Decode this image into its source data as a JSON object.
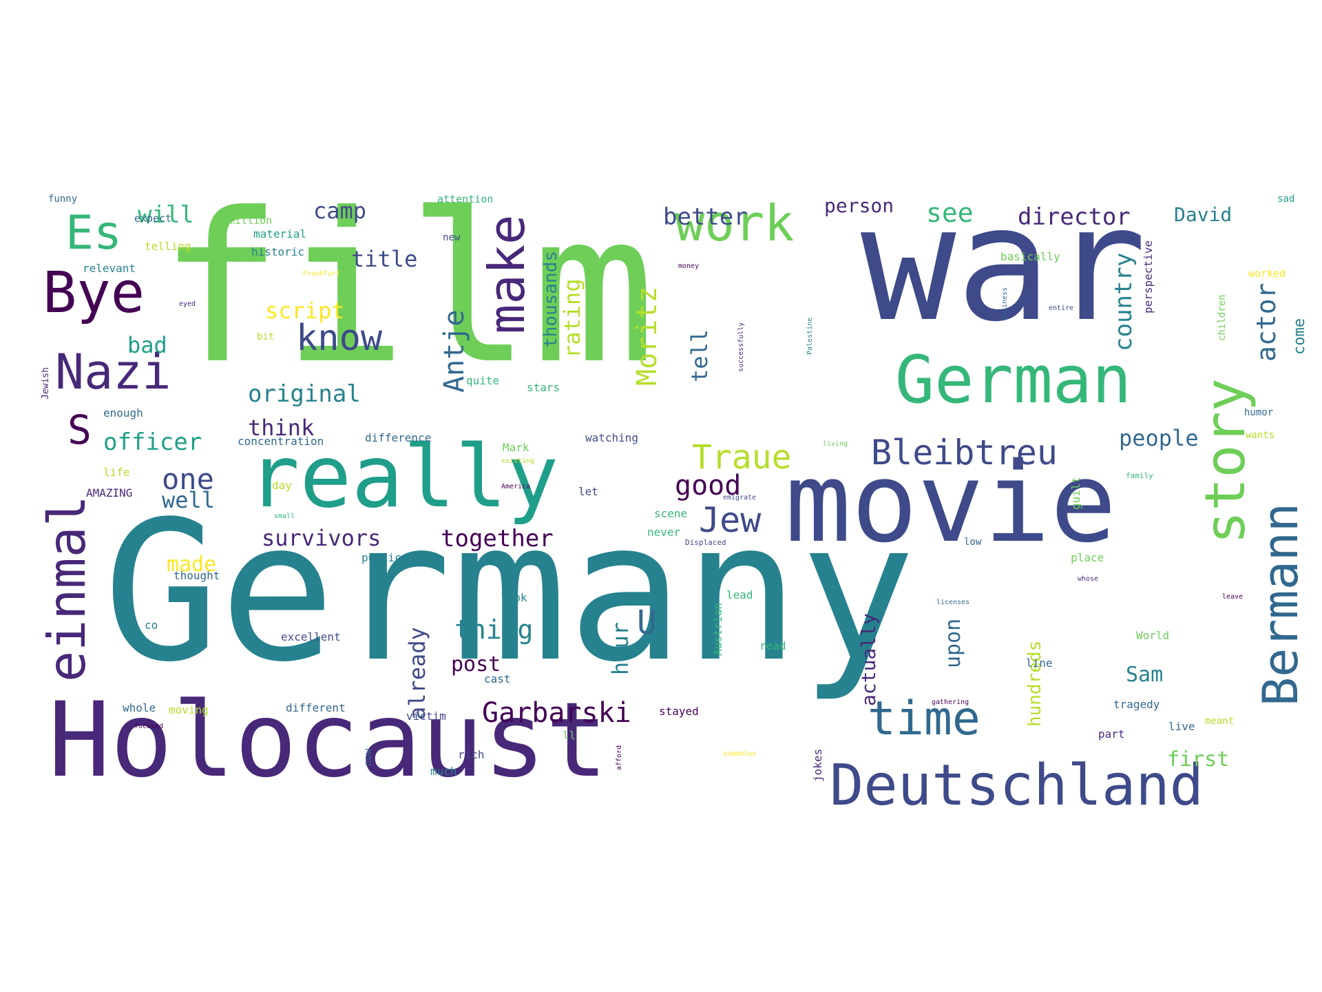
{
  "colors": {
    "background": "#ffffff",
    "palette": [
      "#440154",
      "#482878",
      "#3e4a89",
      "#31688e",
      "#26828e",
      "#1f9e89",
      "#35b779",
      "#6ece58",
      "#b5de2b",
      "#fde725"
    ]
  },
  "words": [
    "Germany",
    "film",
    "war",
    "movie",
    "Holocaust",
    "really",
    "German",
    "Deutschland",
    "story",
    "Bermann",
    "einmal",
    "Nazi",
    "Bye",
    "work",
    "make",
    "time",
    "Es",
    "know",
    "Jew",
    "Bleibtreu",
    "S",
    "Garbarski",
    "Traue",
    "Moritz",
    "Antje",
    "actor",
    "country",
    "U",
    "good",
    "together",
    "survivors",
    "thing",
    "people",
    "one",
    "well",
    "officer",
    "think",
    "original",
    "script",
    "bad",
    "rating",
    "tell",
    "see",
    "better",
    "director",
    "David",
    "camp",
    "will",
    "title",
    "person",
    "thousands",
    "already",
    "actually",
    "hour",
    "upon",
    "first",
    "post",
    "Sam",
    "made",
    "hundreds",
    "come",
    "funny",
    "expect",
    "telling",
    "relevant",
    "million",
    "material",
    "historic",
    "attention",
    "new",
    "basically",
    "worked",
    "sad",
    "perspective",
    "children",
    "humor",
    "wants",
    "family",
    "money",
    "Frankfurt",
    "eyed",
    "entire",
    "business",
    "Palestine",
    "successfully",
    "enough",
    "concentration",
    "difference",
    "watching",
    "Mark",
    "existing",
    "living",
    "quite",
    "stars",
    "life",
    "AMAZING",
    "day",
    "America",
    "let",
    "emigrate",
    "guilt",
    "small",
    "scene",
    "never",
    "Displaced",
    "low",
    "public",
    "place",
    "thought",
    "whose",
    "look",
    "lead",
    "Austrian",
    "licenses",
    "leave",
    "co",
    "excellent",
    "read",
    "World",
    "line",
    "cast",
    "whole",
    "moving",
    "different",
    "victim",
    "stayed",
    "gathering",
    "tragedy",
    "meant",
    "focused",
    "rich",
    "ll",
    "part",
    "live",
    "now",
    "much",
    "afford",
    "shambles",
    "jokes",
    "Jewish",
    "bit"
  ]
}
